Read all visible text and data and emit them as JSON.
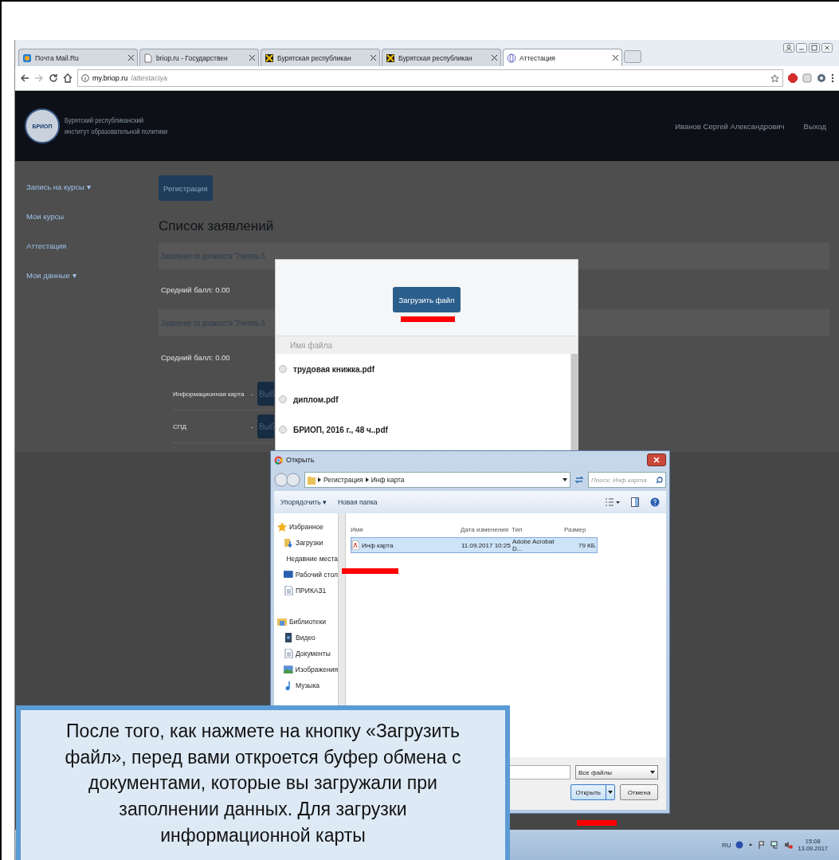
{
  "browser": {
    "tabs": [
      {
        "title": "Почта Mail.Ru",
        "kind": "mail",
        "selected": false
      },
      {
        "title": "briop.ru - Государствен",
        "kind": "page",
        "selected": false
      },
      {
        "title": "Бурятская республикан",
        "kind": "logo",
        "selected": false
      },
      {
        "title": "Бурятская республикан",
        "kind": "logo",
        "selected": false
      },
      {
        "title": "Аттестация",
        "kind": "globe",
        "selected": true
      }
    ],
    "address": {
      "host": "my.briop.ru",
      "path": "/attestaciya"
    }
  },
  "site": {
    "logo_text": "БРИОП",
    "org_name": [
      "Бурятский республиканский",
      "институт образовательной политики"
    ],
    "user": "Иванов Сергей Александрович",
    "logout": "Выход",
    "sidebar": [
      {
        "label": "Запись на курсы",
        "caret": "▾"
      },
      {
        "label": "Мои курсы"
      },
      {
        "label": "Аттестация"
      },
      {
        "label": "Мои данные",
        "caret": "▾"
      }
    ],
    "register_button": "Регистрация",
    "heading": "Список заявлений",
    "applications": [
      {
        "title": "Заявление по должности \"Учитель б",
        "score": "Средний балл: 0.00"
      },
      {
        "title": "Заявление по должности \"Учитель б",
        "score": "Средний балл: 0.00"
      }
    ],
    "documents": [
      {
        "name": "Информационная карта",
        "dash": "-",
        "button": "Выб"
      },
      {
        "name": "СПД",
        "dash": "-",
        "button": "Выб"
      }
    ]
  },
  "modal": {
    "upload_button": "Загрузить файл",
    "column": "Имя файла",
    "files": [
      {
        "name": "трудовая книжка.pdf",
        "selected": false
      },
      {
        "name": "диплом.pdf",
        "selected": false
      },
      {
        "name": "БРИОП, 2016 г., 48 ч..pdf",
        "selected": false
      }
    ]
  },
  "file_dialog": {
    "title": "Открыть",
    "path": [
      "Регистрация",
      "Инф карта"
    ],
    "search_placeholder": "Поиск: Инф карта",
    "organize": "Упорядочить",
    "organize_caret": "▾",
    "new_folder": "Новая папка",
    "nav": [
      {
        "label": "Избранное",
        "kind": "star",
        "children": [
          {
            "label": "Загрузки",
            "kind": "download"
          },
          {
            "label": "Недавние места",
            "kind": "recent"
          },
          {
            "label": "Рабочий стол",
            "kind": "desktop"
          },
          {
            "label": "ПРИКАЗ1",
            "kind": "doc"
          }
        ]
      },
      {
        "label": "Библиотеки",
        "kind": "library",
        "children": [
          {
            "label": "Видео",
            "kind": "video"
          },
          {
            "label": "Документы",
            "kind": "doc"
          },
          {
            "label": "Изображения",
            "kind": "image"
          },
          {
            "label": "Музыка",
            "kind": "music"
          }
        ]
      }
    ],
    "columns": [
      "Имя",
      "Дата изменения",
      "Тип",
      "Размер"
    ],
    "files": [
      {
        "name": "Инф карта",
        "date": "11.09.2017 10:25",
        "type": "Adobe Acrobat D...",
        "size": "79 КБ",
        "selected": true
      }
    ],
    "filter": "Все файлы",
    "open_button": "Открыть",
    "cancel_button": "Отмена"
  },
  "taskbar": {
    "language": "RU",
    "time": "15:08",
    "date": "13.09.2017"
  },
  "callout": "После того, как нажмете на кнопку «Загрузить файл», перед вами откроется буфер обмена с документами, которые вы загружали при заполнении данных. Для загрузки информационной карты"
}
